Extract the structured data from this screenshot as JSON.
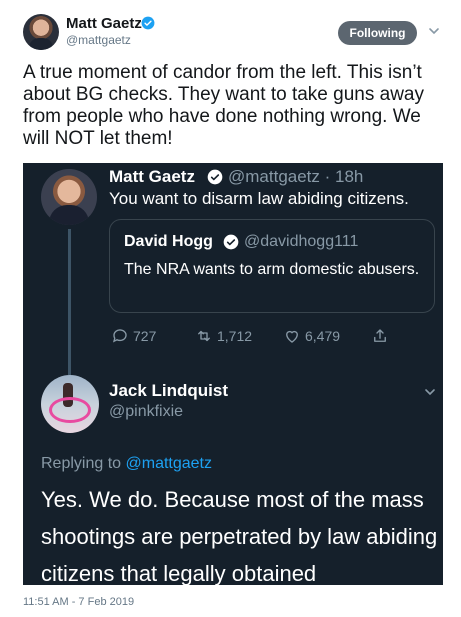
{
  "author": {
    "name": "Matt Gaetz",
    "handle": "@mattgaetz",
    "follow_label": "Following"
  },
  "tweet": {
    "text": "A true moment of candor from the left.  This isn’t about BG checks. They want to take guns away from people who have done nothing wrong. We will NOT let them!",
    "timestamp": "11:51 AM - 7 Feb 2019"
  },
  "embedded": {
    "gaetz_reply": {
      "name": "Matt Gaetz",
      "handle": "@mattgaetz · 18h",
      "text": "You want to disarm law abiding citizens."
    },
    "quote": {
      "name": "David Hogg",
      "handle": "@davidhogg111",
      "text": "The NRA wants to arm domestic abusers."
    },
    "actions": {
      "replies": "727",
      "retweets": "1,712",
      "likes": "6,479"
    },
    "jack": {
      "name": "Jack Lindquist",
      "handle": "@pinkfixie",
      "replying_prefix": "Replying to",
      "replying_to": "@mattgaetz",
      "text": "Yes. We do. Because most of the mass shootings are perpetrated by law abiding citizens that legally obtained"
    }
  },
  "colors": {
    "twitter_blue": "#1da1f2",
    "dark_bg": "#15202b",
    "muted": "#8899a6"
  }
}
